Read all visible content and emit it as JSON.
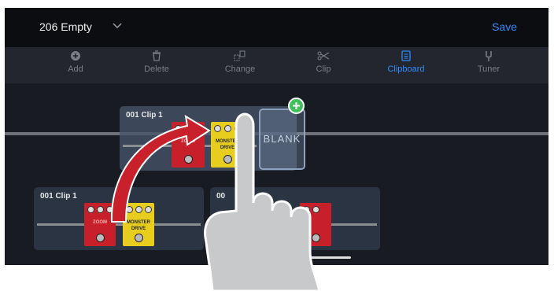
{
  "header": {
    "patch_name": "206 Empty",
    "save_label": "Save"
  },
  "toolbar": {
    "items": [
      {
        "label": "Add",
        "icon": "plus-circle-icon",
        "active": false
      },
      {
        "label": "Delete",
        "icon": "trash-icon",
        "active": false
      },
      {
        "label": "Change",
        "icon": "swap-icon",
        "active": false
      },
      {
        "label": "Clip",
        "icon": "scissors-icon",
        "active": false
      },
      {
        "label": "Clipboard",
        "icon": "clipboard-icon",
        "active": true
      },
      {
        "label": "Tuner",
        "icon": "tuning-fork-icon",
        "active": false
      }
    ]
  },
  "clipboard": {
    "floating_clip_title": "001 Clip 1",
    "blank_label": "BLANK",
    "bottom_clip_title": "001 Clip 1",
    "second_clip_title": "00"
  },
  "pedals": {
    "red_label": "ZOOM",
    "yellow_label_1": "MONSTER",
    "yellow_label_2": "DRIVE"
  },
  "colors": {
    "accent": "#2f8bff",
    "add_green": "#3fc05a",
    "arrow_red": "#c8212b",
    "screen_bg": "#181b22"
  }
}
